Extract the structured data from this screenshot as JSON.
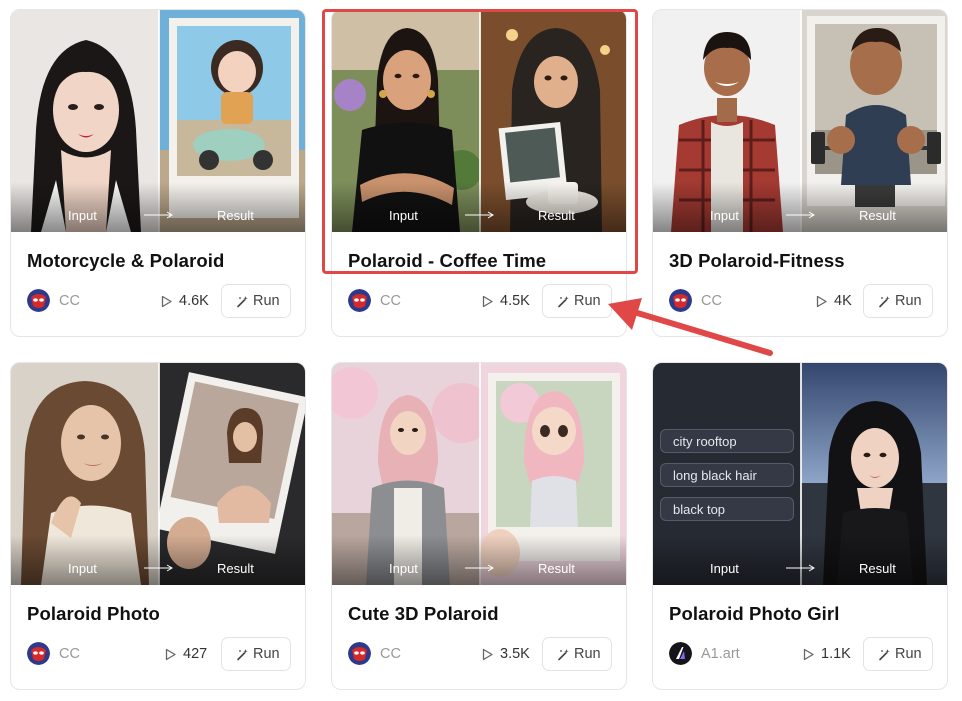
{
  "labels": {
    "input": "Input",
    "result": "Result",
    "run": "Run"
  },
  "cards": [
    {
      "title": "Motorcycle & Polaroid",
      "author": "CC",
      "plays": "4.6K"
    },
    {
      "title": "Polaroid - Coffee Time",
      "author": "CC",
      "plays": "4.5K"
    },
    {
      "title": "3D Polaroid-Fitness",
      "author": "CC",
      "plays": "4K"
    },
    {
      "title": "Polaroid Photo",
      "author": "CC",
      "plays": "427"
    },
    {
      "title": "Cute 3D Polaroid",
      "author": "CC",
      "plays": "3.5K"
    },
    {
      "title": "Polaroid Photo Girl",
      "author": "A1.art",
      "plays": "1.1K",
      "prompt_chips": [
        "city rooftop",
        "long black hair",
        "black top"
      ]
    }
  ],
  "colors": {
    "highlight": "#e04848",
    "author": "#999999",
    "title": "#111111"
  },
  "icons": {
    "plays": "play-icon",
    "run": "magic-wand-icon",
    "avatar_cc": "spider-avatar-icon",
    "avatar_a1": "a1-logo-icon"
  }
}
